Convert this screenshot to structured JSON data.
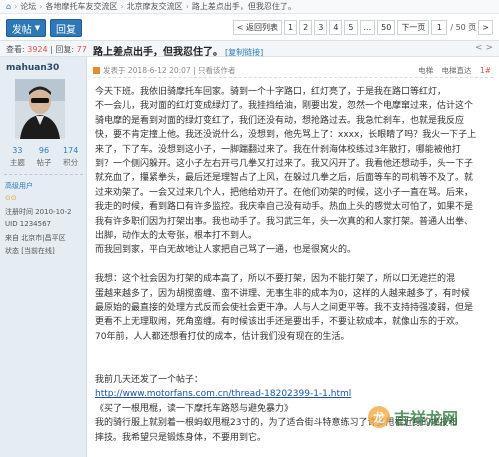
{
  "breadcrumb": [
    "论坛",
    "各地摩托车友交流区",
    "北京摩友交流区",
    "路上差点出手，但我忍住了。"
  ],
  "toolbar": {
    "post_label": "发帖",
    "post_caret": "▼",
    "reply_label": "回复"
  },
  "pager": {
    "prev": "< 返回列表",
    "pages": [
      "1",
      "2",
      "3",
      "4",
      "5",
      "...",
      "50"
    ],
    "next": "下一页",
    "page_input": "1",
    "total": "/ 50 页",
    "next_btn": ">"
  },
  "header": {
    "views_label": "查看: ",
    "views": "3924",
    "sep": " | ",
    "replies_label": "回复: ",
    "replies": "77",
    "title": "路上差点出手，但我忍住了。",
    "copy_link": "[复制链接]",
    "nav_prev": "<",
    "nav_next": ">"
  },
  "author": {
    "name": "mahuan30",
    "stats": [
      {
        "value": "33",
        "label": "主题"
      },
      {
        "value": "96",
        "label": "帖子"
      },
      {
        "value": "174",
        "label": "积分"
      }
    ],
    "meta": [
      "高级用户",
      "⊙⊙",
      "注册时间  2010-10-2",
      "UID  1234567",
      "来自  北京市|昌平区",
      "状态  [当前在线]"
    ]
  },
  "post": {
    "posted": "发表于 2018-6-12 20:07",
    "author_only": "| 只看该作者",
    "tools": [
      "电梯",
      "电梯直达"
    ],
    "floor": "1#",
    "lines": [
      "今天下班。我依旧骑摩托车回家。骑到一个十字路口，红灯亮了，于是我在路口等红灯，",
      "不一会儿，我对面的红灯变成绿灯了。我挂挡给油，刚要出发，忽然一个电摩窜过来，估计这个",
      "骑电摩的是看到对面的绿灯变红了，我们还没有动，想抢路过去。我急忙刹车，也就是我反应",
      "快，要不肯定撞上他。我还没说什么，没想到，他先骂上了：xxxx，长眼睛了吗？我火一下子上",
      "来了，下了车。没想到这小子，一脚踹翻过来了。我在什刹海体校练过3年散打，哪能被他打",
      "到？一个侧闪躲开。这小子左右开弓几拳又打过来了。我又闪开了。我看他还想动手，头一下子",
      "就充血了，攥紧拳头，最后还是理智占了上风，在躲过几拳之后，后面等车的司机等不及了。就",
      "过来劝架了。一会又过来几个人，把他给劝开了。在他们劝架的时候，这小子一直在骂。后来，",
      "我走的时候，看到路口有许多监控。我庆幸自己没有动手。热血上头的感觉太可怕了，如果不是",
      "我有许多职们因为打架出事。我也动手了。我习武三年，头一次真的和人家打架。普通人出拳、",
      "出脚，动作太的太夸张，根本打不到人。",
      "   而我回到家，平白无故地让人家把自己骂了一通，也是很窝火的。",
      "",
      "   我想：这个社会因为打架的成本高了，所以不要打架，因为不能打架了，所以口无遮拦的混",
      "蛋越来越多了，因为胡搅蛮缠、蛮不讲理、无事生非的成本为0，这样的人越来越多了，有时候",
      "最原始的最直接的处理方式反而会使社会更干净。人与人之间更平等。我不支持持强凌弱，但是",
      "更看不上无理取闹，死角蛮缠。有时候该出手还是要出手，不要让软成本，就像山东的于欢。",
      "70年前，人人都还想看打仗的成本，估计我们没有现在的生活。",
      "",
      "",
      "我前几天还发了一个帖子：",
      "http://www.motorfans.com.cn/thread-18202399-1-1.html",
      "《买了一根甩棍，读一下摩托车路怒与避免暴力》",
      "我的骑行服上就别着一根蚂蚁甩棍23寸的，为了适合街斗特意练习了许多甩棍近身的撞技和",
      "摔技。我希望只是锻炼身体，不要用到它。"
    ],
    "link_index": 21
  },
  "watermark": {
    "text": "吉祥龙网",
    "logo_glyph": "龙"
  }
}
